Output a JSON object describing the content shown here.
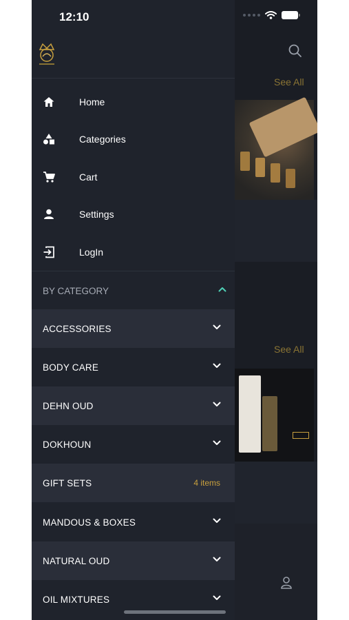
{
  "status_bar": {
    "time": "12:10"
  },
  "background": {
    "see_all_1": "See All",
    "see_all_2": "See All"
  },
  "nav": [
    {
      "label": "Home",
      "icon": "home-icon"
    },
    {
      "label": "Categories",
      "icon": "shapes-icon"
    },
    {
      "label": "Cart",
      "icon": "cart-icon"
    },
    {
      "label": "Settings",
      "icon": "person-icon"
    },
    {
      "label": "LogIn",
      "icon": "login-icon"
    }
  ],
  "category_section": {
    "title": "BY CATEGORY"
  },
  "categories": [
    {
      "label": "ACCESSORIES"
    },
    {
      "label": "BODY CARE"
    },
    {
      "label": "DEHN OUD"
    },
    {
      "label": "DOKHOUN"
    },
    {
      "label": "GIFT SETS",
      "count": "4 items"
    },
    {
      "label": "MANDOUS & BOXES"
    },
    {
      "label": "NATURAL OUD"
    },
    {
      "label": "OIL MIXTURES"
    }
  ],
  "colors": {
    "accent_gold": "#c8a03e",
    "chevron_up_teal": "#4fd1b6",
    "drawer_bg": "#1f232c"
  }
}
